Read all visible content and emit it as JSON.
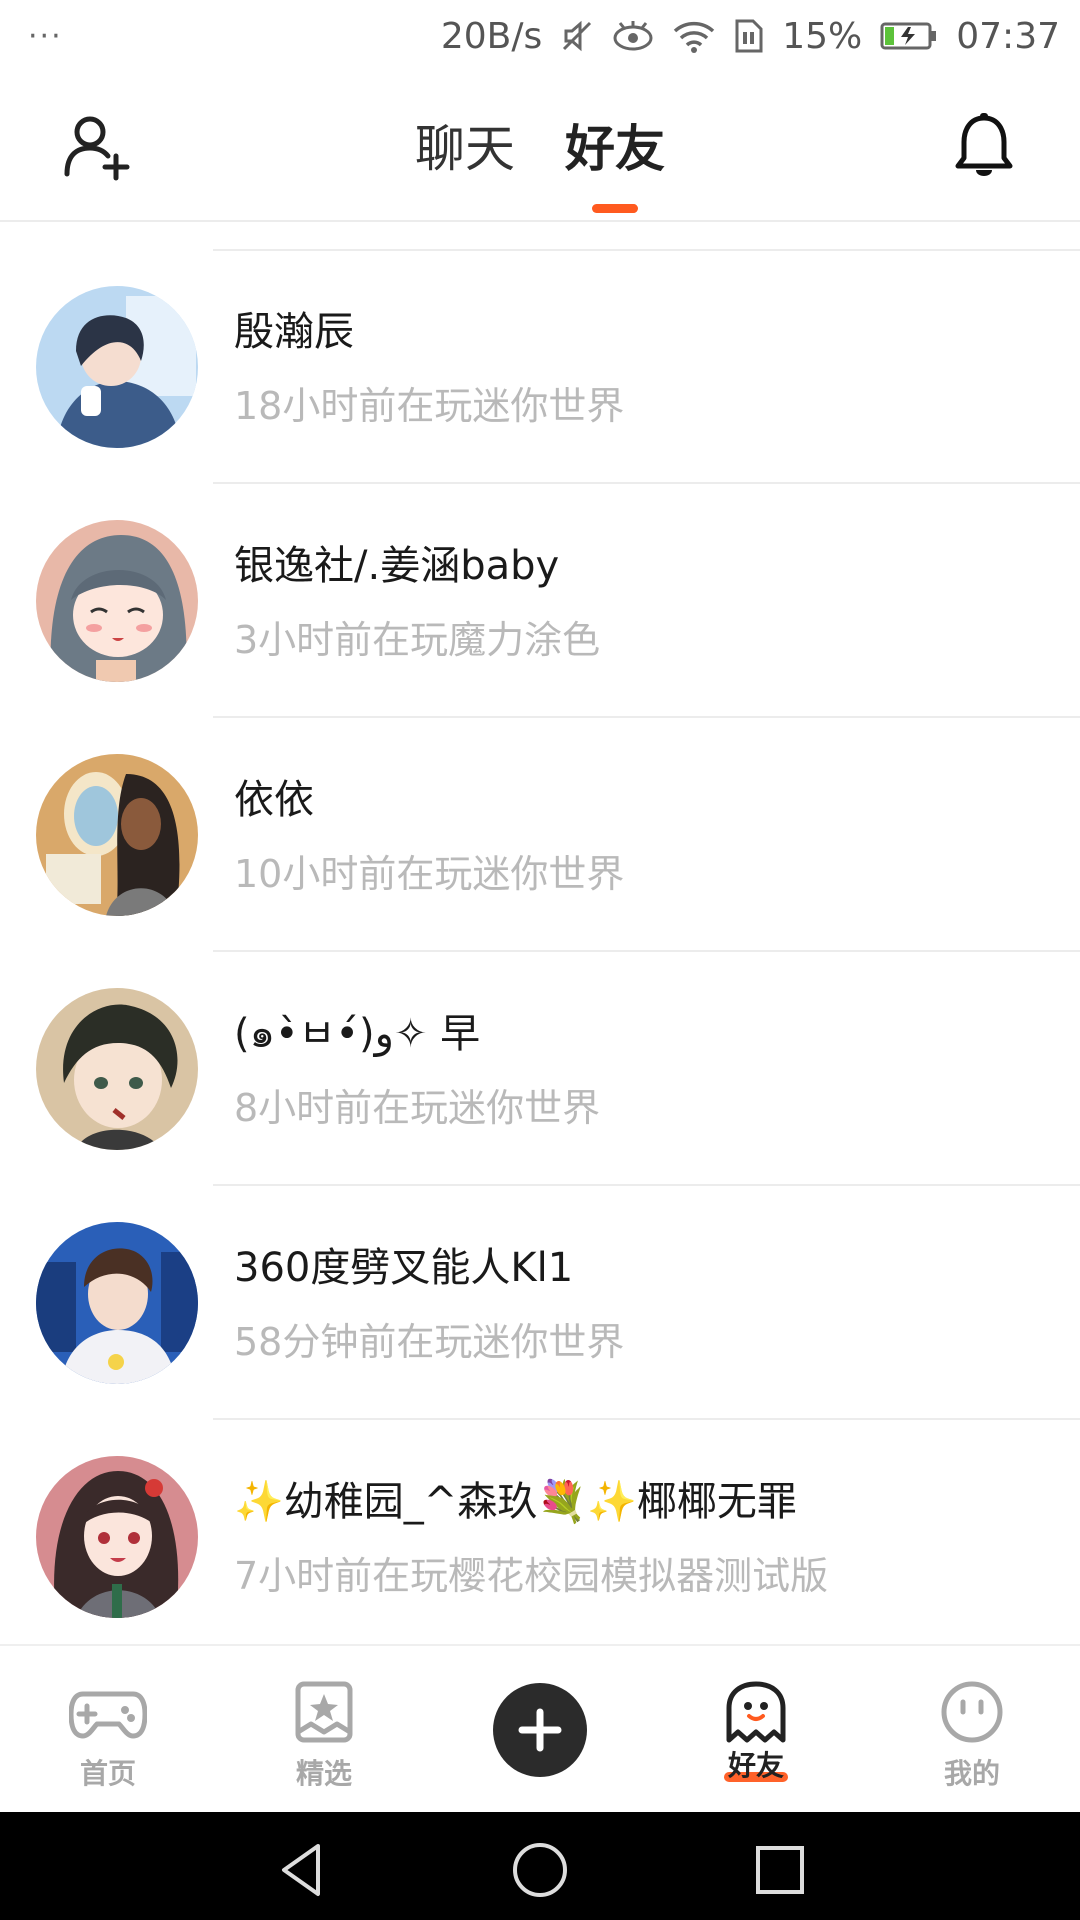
{
  "status_bar": {
    "dots": "···",
    "net_speed": "20B/s",
    "battery": "15%",
    "time": "07:37"
  },
  "header": {
    "tabs": [
      {
        "label": "聊天",
        "active": false
      },
      {
        "label": "好友",
        "active": true
      }
    ],
    "accent": "#ff5a1f"
  },
  "friends": [
    {
      "name": "殷瀚辰",
      "status": "18小时前在玩迷你世界"
    },
    {
      "name": "银逸社/.姜涵baby",
      "status": "3小时前在玩魔力涂色"
    },
    {
      "name": "依依",
      "status": "10小时前在玩迷你世界"
    },
    {
      "name": "(๑•̀ㅂ•́)و✧ 早",
      "status": "8小时前在玩迷你世界"
    },
    {
      "name": "360度劈叉能人Kl1",
      "status": "58分钟前在玩迷你世界"
    },
    {
      "name": "✨幼稚园_^森玖💐✨椰椰无罪",
      "status": "7小时前在玩樱花校园模拟器测试版"
    }
  ],
  "bottom_nav": {
    "items": [
      {
        "label": "首页",
        "icon": "gamepad-icon"
      },
      {
        "label": "精选",
        "icon": "star-bookmark-icon"
      },
      {
        "label": "好友",
        "icon": "ghost-icon",
        "active": true
      },
      {
        "label": "我的",
        "icon": "smiley-icon"
      }
    ]
  }
}
